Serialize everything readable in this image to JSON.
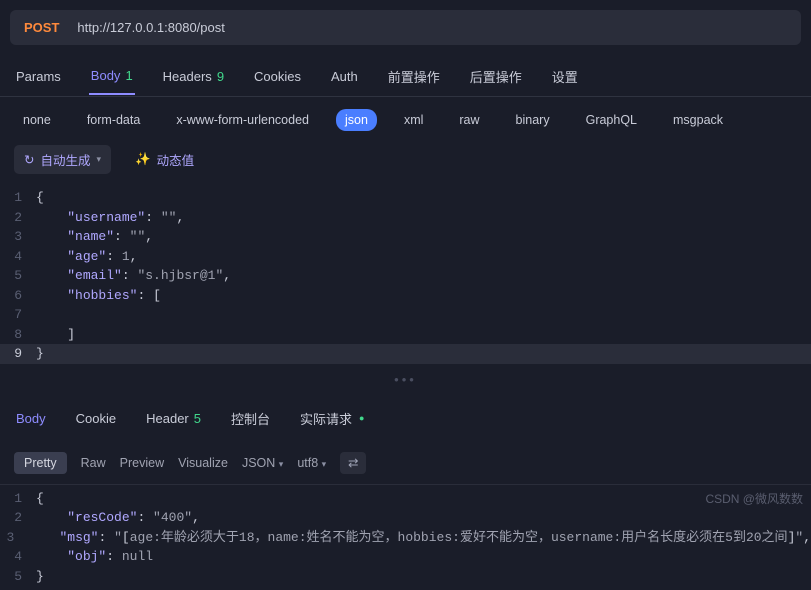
{
  "request": {
    "method": "POST",
    "url": "http://127.0.0.1:8080/post"
  },
  "tabs": {
    "params": "Params",
    "body": "Body",
    "body_badge": "1",
    "headers": "Headers",
    "headers_badge": "9",
    "cookies": "Cookies",
    "auth": "Auth",
    "pre": "前置操作",
    "post": "后置操作",
    "settings": "设置"
  },
  "body_types": {
    "none": "none",
    "form_data": "form-data",
    "urlencoded": "x-www-form-urlencoded",
    "json": "json",
    "xml": "xml",
    "raw": "raw",
    "binary": "binary",
    "graphql": "GraphQL",
    "msgpack": "msgpack"
  },
  "tools": {
    "autogen": "自动生成",
    "dynamic": "动态值"
  },
  "editor_lines": [
    "{",
    "    \"username\": \"\",",
    "    \"name\": \"\",",
    "    \"age\": 1,",
    "    \"email\": \"s.hjbsr@1\",",
    "    \"hobbies\": [",
    "",
    "    ]",
    "}"
  ],
  "request_body_json": {
    "username": "",
    "name": "",
    "age": 1,
    "email": "s.hjbsr@1",
    "hobbies": []
  },
  "resp_tabs": {
    "body": "Body",
    "cookie": "Cookie",
    "header": "Header",
    "header_badge": "5",
    "console": "控制台",
    "actual": "实际请求"
  },
  "resp_sub": {
    "pretty": "Pretty",
    "raw": "Raw",
    "preview": "Preview",
    "visualize": "Visualize",
    "format": "JSON",
    "encoding": "utf8"
  },
  "response_lines": [
    "{",
    "    \"resCode\": \"400\",",
    "    \"msg\": \"[age:年龄必须大于18，name:姓名不能为空，hobbies:爱好不能为空，username:用户名长度必须在5到20之间]\",",
    "    \"obj\": null",
    "}"
  ],
  "response_body_json": {
    "resCode": "400",
    "msg": "[age:年龄必须大于18，name:姓名不能为空，hobbies:爱好不能为空，username:用户名长度必须在5到20之间]",
    "obj": null
  },
  "watermark": "CSDN @微风数数"
}
